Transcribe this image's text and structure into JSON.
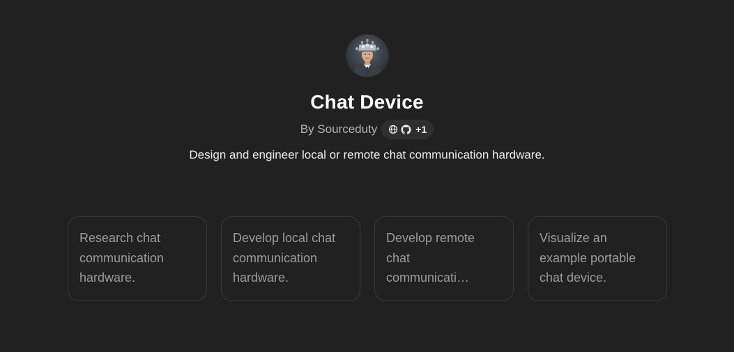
{
  "gpt": {
    "avatar_icon": "robot-helmet-avatar-icon",
    "title": "Chat Device",
    "author": "By Sourceduty",
    "badge": {
      "icons": [
        "globe-icon",
        "github-icon"
      ],
      "extra_count": "+1"
    },
    "description": "Design and engineer local or remote chat communication hardware."
  },
  "starters": [
    {
      "text": "Research chat communication hardware."
    },
    {
      "text": "Develop local chat communication hardware."
    },
    {
      "text": "Develop remote chat communication hardware."
    },
    {
      "text": "Visualize an example portable chat device."
    }
  ],
  "colors": {
    "background": "#212121",
    "card_border": "#3a3a3a",
    "badge_background": "#2f2f2f",
    "muted_text": "#9b9b9b"
  }
}
